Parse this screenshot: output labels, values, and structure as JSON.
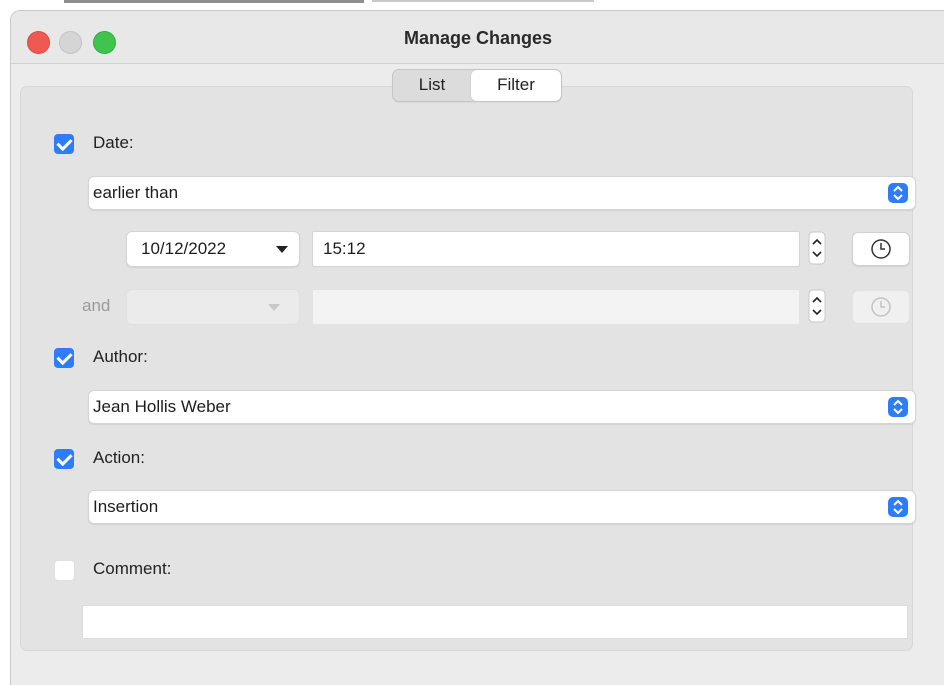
{
  "window": {
    "title": "Manage Changes"
  },
  "tabs": [
    {
      "label": "List",
      "active": false
    },
    {
      "label": "Filter",
      "active": true
    }
  ],
  "date": {
    "label": "Date:",
    "checked": true,
    "condition": "earlier than",
    "date_value": "10/12/2022",
    "time_value": "15:12",
    "and_label": "and",
    "and_date_value": "",
    "and_time_value": ""
  },
  "author": {
    "label": "Author:",
    "checked": true,
    "value": "Jean Hollis Weber"
  },
  "action": {
    "label": "Action:",
    "checked": true,
    "value": "Insertion"
  },
  "comment": {
    "label": "Comment:",
    "checked": false,
    "value": ""
  },
  "colors": {
    "accent": "#2f7df6",
    "close": "#ee5a52",
    "zoom": "#3fc54d"
  }
}
